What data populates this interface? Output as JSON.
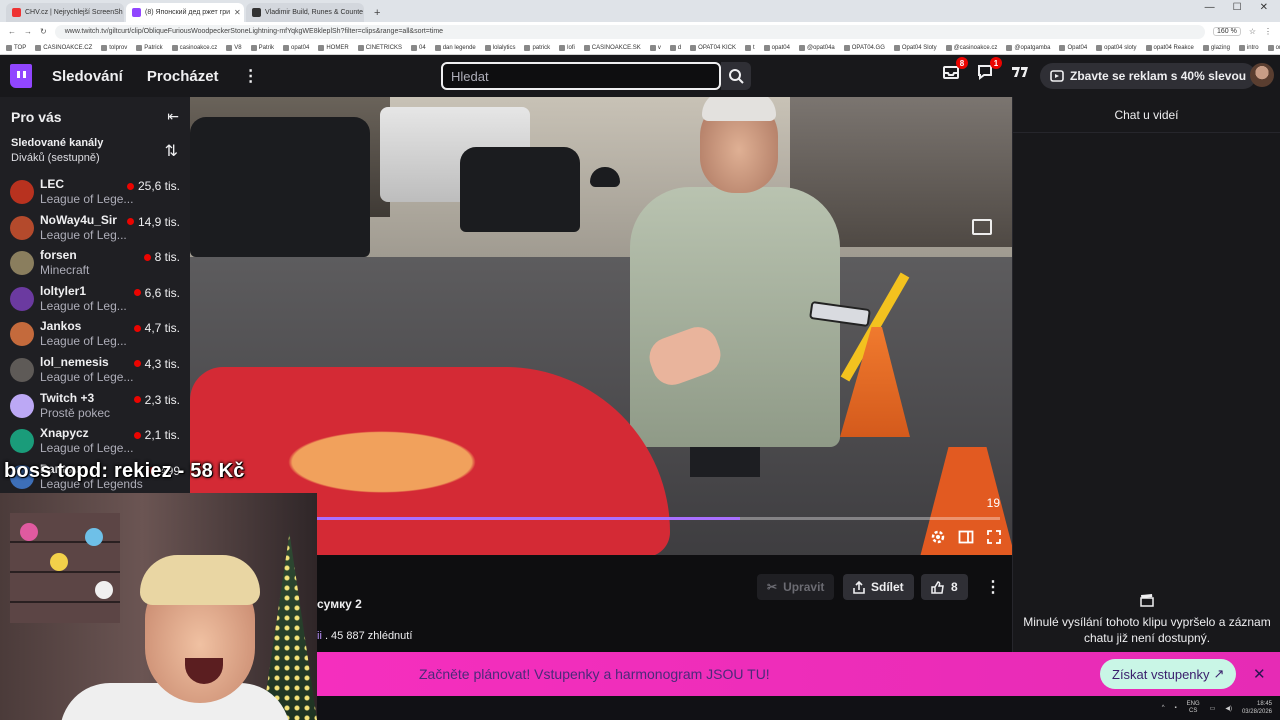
{
  "browser": {
    "tabs": [
      {
        "title": "CHV.cz | Nejrychlejší ScreenSh",
        "active": false,
        "color": "#e33"
      },
      {
        "title": "(8) Японский дед ржет гри",
        "active": true,
        "color": "#9146ff"
      },
      {
        "title": "Vladimir Build, Runes & Counte",
        "active": false,
        "color": "#333"
      }
    ],
    "url": "www.twitch.tv/giltcurt/clip/ObliqueFuriousWoodpeckerStoneLightning-mfYqkgWE8kleplSh?filter=clips&range=all&sort=time",
    "zoom": "160 %",
    "bookmarks": [
      "TOP",
      "CASINOAKCE.CZ",
      "tolprov",
      "Patrick",
      "casinoakce.cz",
      "V8",
      "Patrik",
      "opat04",
      "HOMER",
      "CINETRICKS",
      "04",
      "dan legende",
      "lolalytics",
      "patrick",
      "lofi",
      "CASINOAKCE.SK",
      "v",
      "d",
      "OPAT04 KICK",
      "t",
      "opat04",
      "@opat04a",
      "OPAT04.GG",
      "Opat04 Sloty",
      "@casinoakce.cz",
      "@opatgamba",
      "Opat04",
      "opat04 sloty",
      "opat04 Reakce",
      "glazing",
      "intro",
      "outro"
    ]
  },
  "nav": {
    "following": "Sledování",
    "browse": "Procházet",
    "search_placeholder": "Hledat",
    "inbox_badge": "8",
    "whispers_badge": "1",
    "adfree_label": "Zbavte se reklam s 40% slevou"
  },
  "sidebar": {
    "title": "Pro vás",
    "section_title": "Sledované kanály",
    "section_sub": "Diváků (sestupně)",
    "channels": [
      {
        "name": "LEC",
        "game": "League of Lege...",
        "viewers": "25,6 tis.",
        "color": "#b8321f"
      },
      {
        "name": "NoWay4u_Sir",
        "game": "League of Leg...",
        "viewers": "14,9 tis.",
        "color": "#b44a2c"
      },
      {
        "name": "forsen",
        "game": "Minecraft",
        "viewers": "8 tis.",
        "color": "#8a7e5e"
      },
      {
        "name": "loltyler1",
        "game": "League of Leg...",
        "viewers": "6,6 tis.",
        "color": "#6b3aa0"
      },
      {
        "name": "Jankos",
        "game": "League of Leg...",
        "viewers": "4,7 tis.",
        "color": "#c46a3c"
      },
      {
        "name": "lol_nemesis",
        "game": "League of Lege...",
        "viewers": "4,3 tis.",
        "color": "#5e5a57"
      },
      {
        "name": "Twitch +3",
        "game": "Prostě pokec",
        "viewers": "2,3 tis.",
        "color": "#bca8f5"
      },
      {
        "name": "Xnapycz",
        "game": "League of Lege...",
        "viewers": "2,1 tis.",
        "color": "#1a9c7a"
      },
      {
        "name": "Pantsu",
        "game": "League of Legends",
        "viewers": "499",
        "color": "#3d6fb8"
      }
    ]
  },
  "video": {
    "counter": "19",
    "progress": 0.62
  },
  "clip": {
    "title": "сумку 2",
    "views_link": "ii",
    "views": " . 45 887 zhlédnutí",
    "edit_label": "Upravit",
    "share_label": "Sdílet",
    "likes": "8"
  },
  "chat": {
    "header": "Chat u videí",
    "note": "Minulé vysílání tohoto klipu vypršelo a záznam chatu již není dostupný."
  },
  "banner": {
    "text": "Začněte plánovat! Vstupenky a harmonogram JSOU TU!",
    "button": "Získat vstupenky"
  },
  "overlay": {
    "donation": "boss topd:  rekiez - 58 Kč"
  },
  "tray": {
    "lang": "ENG",
    "lang2": "CS",
    "time": "18:45",
    "date": "03/28/2026"
  }
}
